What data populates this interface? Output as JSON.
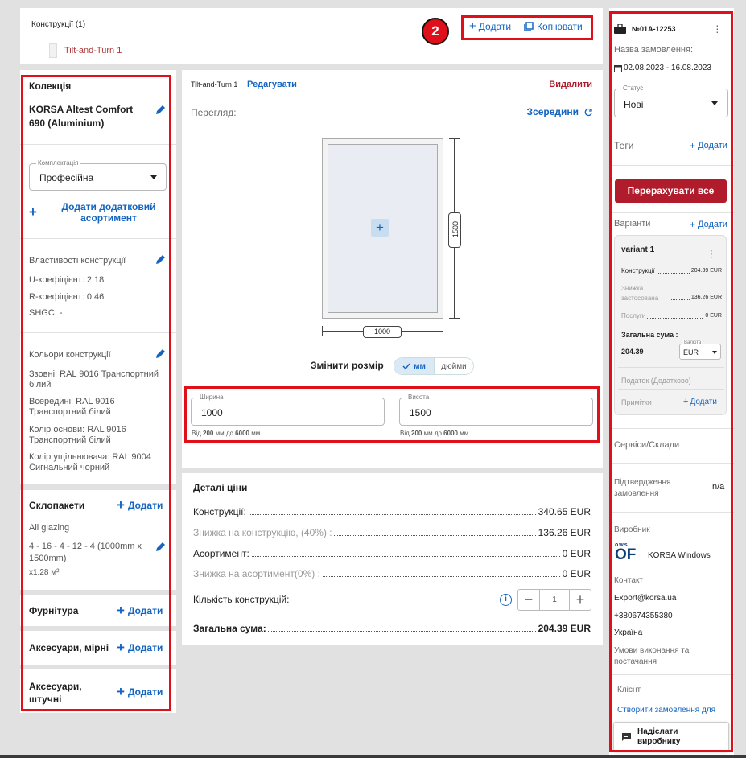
{
  "top": {
    "constructions_label": "Конструкції (1)",
    "construction_item": "Tilt-and-Turn 1",
    "badge": "2",
    "add_label": "Додати",
    "copy_label": "Копіювати"
  },
  "collection": {
    "title": "Колекція",
    "name": "KORSA Altest Comfort 690 (Aluminium)",
    "kit_label": "Комплектація",
    "kit_value": "Професійна",
    "add_assortment": "Додати додатковий асортимент",
    "properties_title": "Властивості конструкції",
    "u": "U-коефіцієнт: 2.18",
    "r": "R-коефіцієнт: 0.46",
    "shgc": "SHGC: -",
    "colors_title": "Кольори конструкції",
    "outside": "Ззовні: RAL 9016 Транспортний білий",
    "inside": "Всередині: RAL 9016 Транспортний білий",
    "base": "Колір основи: RAL 9016 Транспортний білий",
    "seal": "Колір ущільнювача: RAL 9004 Сигнальний чорний"
  },
  "glazing": {
    "title": "Склопакети",
    "add": "Додати",
    "all": "All glazing",
    "spec": "4 - 16 - 4 - 12 - 4 (1000mm x 1500mm)",
    "area": "x1.28 м²"
  },
  "hardware": {
    "title": "Фурнітура",
    "add": "Додати"
  },
  "acc_mirni": {
    "title": "Аксесуари, мірні",
    "add": "Додати"
  },
  "acc_shtuchni": {
    "title": "Аксесуари, штучні",
    "add": "Додати"
  },
  "editor": {
    "name": "Tilt-and-Turn 1",
    "edit": "Редагувати",
    "delete": "Видалити",
    "view_label": "Перегляд:",
    "view_value": "Зсередини",
    "dim_height": "1500",
    "dim_width": "1000",
    "resize_label": "Змінити розмір",
    "unit_mm": "мм",
    "unit_in": "дюйми",
    "width_label": "Ширина",
    "width_value": "1000",
    "height_label": "Висота",
    "height_value": "1500",
    "width_hint_pre": "Від ",
    "width_hint_min": "200",
    "width_hint_mid": " мм до ",
    "width_hint_max": "6000",
    "width_hint_post": " мм"
  },
  "price": {
    "title": "Деталі ціни",
    "rows": [
      {
        "label": "Конструкції:",
        "value": "340.65 EUR"
      },
      {
        "label": "Знижка на конструкцію, (40%) :",
        "value": "136.26 EUR"
      },
      {
        "label": "Асортимент:",
        "value": "0 EUR"
      },
      {
        "label": "Знижка на асортимент(0%) :",
        "value": "0 EUR"
      }
    ],
    "qty_label": "Кількість конструкцій:",
    "qty_value": "1",
    "total_label": "Загальна сума:",
    "total_value": "204.39 EUR"
  },
  "order": {
    "number": "№01A-12253",
    "name_label": "Назва замовлення:",
    "dates": "02.08.2023 - 16.08.2023",
    "status_label": "Статус",
    "status_value": "Нові",
    "tags": "Теги",
    "tags_add": "Додати",
    "recalc": "Перерахувати все",
    "variants": "Варіанти",
    "variants_add": "Додати",
    "variant_name": "variant 1",
    "v_constructions": "Конструкції",
    "v_constructions_val": "204.39 EUR",
    "v_discount": "Знижка застосована",
    "v_discount_val": "136.26 EUR",
    "v_services": "Послуги",
    "v_services_val": "0 EUR",
    "v_total_label": "Загальна сума :",
    "v_total": "204.39",
    "currency_label": "Валюта",
    "currency": "EUR",
    "tax": "Податок (Додатково)",
    "notes": "Примітки",
    "notes_add": "Додати",
    "services": "Сервіси/Склади",
    "confirm": "Підтвердження замовлення",
    "confirm_val": "n/a",
    "manufacturer": "Виробник",
    "manufacturer_name": "KORSA Windows",
    "contact": "Контакт",
    "email": "Export@korsa.ua",
    "phone": "+380674355380",
    "country": "Україна",
    "terms": "Умови виконання та постачання",
    "client": "Клієнт",
    "create_for": "Створити замовлення для",
    "send": "Надіслати виробнику"
  },
  "colors": {
    "accent": "#1565c0",
    "danger": "#b01c2b",
    "highlight": "#e0101a"
  }
}
